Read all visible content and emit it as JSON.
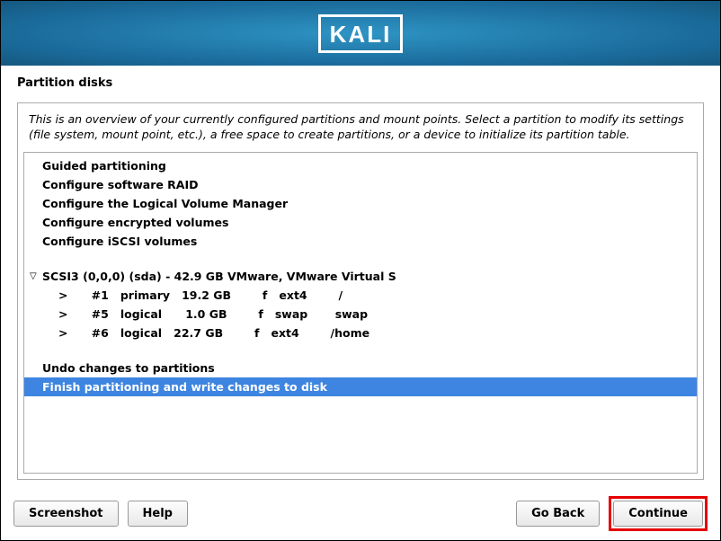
{
  "logo_text": "KALI",
  "page_title": "Partition disks",
  "description": "This is an overview of your currently configured partitions and mount points. Select a partition to modify its settings (file system, mount point, etc.), a free space to create partitions, or a device to initialize its partition table.",
  "menu": {
    "guided": "Guided partitioning",
    "raid": "Configure software RAID",
    "lvm": "Configure the Logical Volume Manager",
    "encrypted": "Configure encrypted volumes",
    "iscsi": "Configure iSCSI volumes"
  },
  "disk": {
    "header": "SCSI3 (0,0,0) (sda) - 42.9 GB VMware, VMware Virtual S",
    "partitions": [
      {
        "marker": ">",
        "num": "#1",
        "type": "primary",
        "size": "19.2 GB",
        "flag": "f",
        "fs": "ext4",
        "mount": "/"
      },
      {
        "marker": ">",
        "num": "#5",
        "type": "logical",
        "size": "1.0 GB",
        "flag": "f",
        "fs": "swap",
        "mount": "swap"
      },
      {
        "marker": ">",
        "num": "#6",
        "type": "logical",
        "size": "22.7 GB",
        "flag": "f",
        "fs": "ext4",
        "mount": "/home"
      }
    ]
  },
  "actions": {
    "undo": "Undo changes to partitions",
    "finish": "Finish partitioning and write changes to disk"
  },
  "buttons": {
    "screenshot": "Screenshot",
    "help": "Help",
    "goback": "Go Back",
    "continue": "Continue"
  }
}
